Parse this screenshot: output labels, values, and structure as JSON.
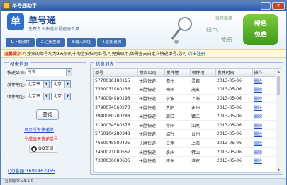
{
  "window": {
    "title": "单号通助手",
    "minimize": "—",
    "close": "✕"
  },
  "banner": {
    "logo_glyph": "单",
    "brand": "单号通",
    "slogan": "免费专业快递单号查询工具",
    "steps": [
      "1.下载软件",
      "2.注册登录",
      "3.输入网址",
      "4.使用说明"
    ],
    "decor_words": [
      "操作简单",
      "绿色",
      "免费"
    ],
    "badge_line1": "绿色",
    "badge_line2": "免费",
    "accent": "#3f9a1c"
  },
  "notice": {
    "label": "温馨提示",
    "text": ":可搜索的单号均为2天前的非淘宝拍拍网单号,可免费取用,如需查天自定义快递单号,您可",
    "link": "点击注册"
  },
  "search": {
    "title": "搜索信息",
    "courier_label": "快递公司:",
    "courier_value": "所有",
    "from_label": "发件地址:",
    "from_province": "北京市",
    "from_city": "北京",
    "to_label": "收件地址:",
    "to_province": "北京市",
    "to_city": "北京",
    "query_button": "查询",
    "show_all_link": "显示所有快递单",
    "generate_link": "生成当天快递单号",
    "qq_button": "QQ交谈",
    "qq_contact": "QQ客服:1691462965"
  },
  "list": {
    "title": "信息列表",
    "columns": [
      "单号",
      "物流公司",
      "发件地",
      "收件地",
      "发件时间",
      "操作"
    ],
    "rows": [
      [
        "5770016180115",
        "长胜快递",
        "儋州",
        "灵岩",
        "2013-05-06",
        "删除"
      ],
      [
        "7530031980136",
        "长胜快递",
        "梅州",
        "茂名",
        "2013-05-06",
        "删除"
      ],
      [
        "5740094980193",
        "长胜快递",
        "宁波",
        "上海",
        "2013-05-06",
        "删除"
      ],
      [
        "3790074560273",
        "长胜快递",
        "贵阳",
        "永州",
        "2013-05-06",
        "删除"
      ],
      [
        "3940060780288",
        "长胜快递",
        "周口",
        "镇江",
        "2013-05-06",
        "删除"
      ],
      [
        "3190034580376",
        "长胜快递",
        "常州",
        "汕尾",
        "2013-05-06",
        "删除"
      ],
      [
        "5750104280348",
        "长胜快递",
        "绍兴",
        "台州",
        "2013-05-06",
        "删除"
      ],
      [
        "7660045580495",
        "长胜快递",
        "云浮",
        "上海",
        "2013-05-06",
        "删除"
      ],
      [
        "7460021080567",
        "长胜快递",
        "永州",
        "佛山",
        "2013-05-06",
        "删除"
      ],
      [
        "7330036080636",
        "长胜快递",
        "株洲",
        "淮安",
        "2013-05-06",
        "删除"
      ]
    ]
  },
  "statusbar": {
    "version": "当前版本:v3.1.0"
  }
}
